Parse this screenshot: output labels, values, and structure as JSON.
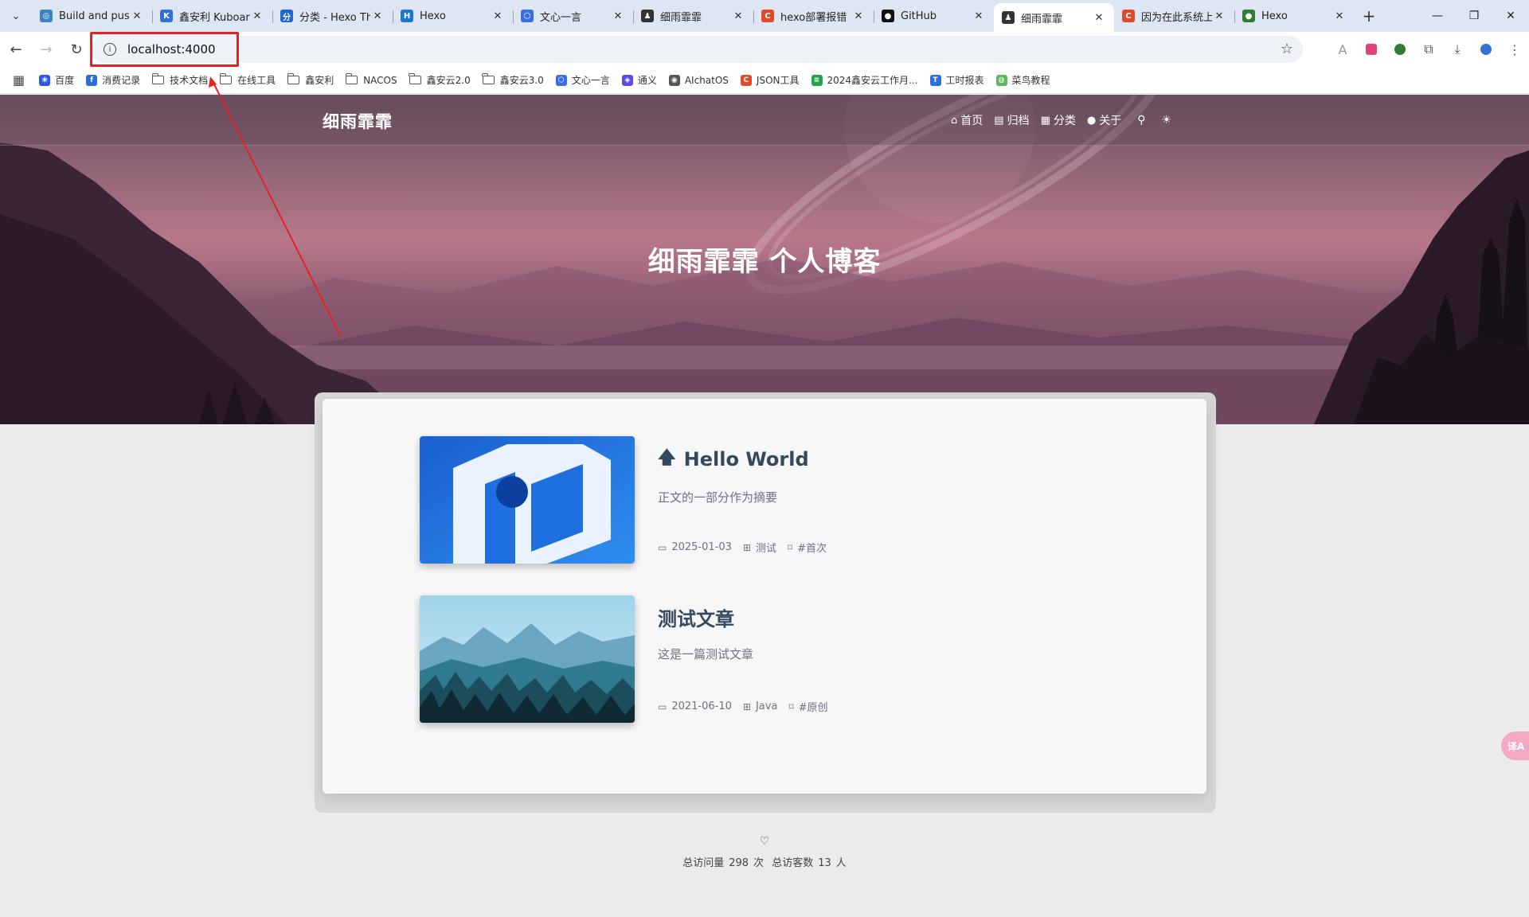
{
  "browser": {
    "tabs": [
      {
        "title": "Build and push",
        "color": "#3b82c4",
        "glyph": "◎"
      },
      {
        "title": "鑫安利 Kuboard",
        "color": "#2f6fdc",
        "glyph": "K"
      },
      {
        "title": "分类 - Hexo Th",
        "color": "#1e66d0",
        "glyph": "分"
      },
      {
        "title": "Hexo",
        "color": "#1976d2",
        "glyph": "H"
      },
      {
        "title": "文心一言",
        "color": "#3b6fe0",
        "glyph": "⬡"
      },
      {
        "title": "细雨霏霏",
        "color": "#333333",
        "glyph": "♟"
      },
      {
        "title": "hexo部署报错",
        "color": "#e0492c",
        "glyph": "C"
      },
      {
        "title": "GitHub",
        "color": "#111111",
        "glyph": "●"
      },
      {
        "title": "细雨霏霏",
        "color": "#333333",
        "glyph": "♟"
      },
      {
        "title": "因为在此系统上",
        "color": "#e0492c",
        "glyph": "C"
      },
      {
        "title": "Hexo",
        "color": "#2e7d32",
        "glyph": "●"
      }
    ],
    "active_tab_index": 8,
    "url": "localhost:4000",
    "bookmarks": [
      {
        "label": "百度",
        "type": "site",
        "color": "#2b56e8",
        "glyph": "❀"
      },
      {
        "label": "消费记录",
        "type": "site",
        "color": "#2a6fdc",
        "glyph": "f"
      },
      {
        "label": "技术文档",
        "type": "folder"
      },
      {
        "label": "在线工具",
        "type": "folder"
      },
      {
        "label": "鑫安利",
        "type": "folder"
      },
      {
        "label": "NACOS",
        "type": "folder"
      },
      {
        "label": "鑫安云2.0",
        "type": "folder"
      },
      {
        "label": "鑫安云3.0",
        "type": "folder"
      },
      {
        "label": "文心一言",
        "type": "site",
        "color": "#3b6fe0",
        "glyph": "⬡"
      },
      {
        "label": "通义",
        "type": "site",
        "color": "#5b4ee0",
        "glyph": "◈"
      },
      {
        "label": "AIchatOS",
        "type": "site",
        "color": "#555555",
        "glyph": "◉"
      },
      {
        "label": "JSON工具",
        "type": "site",
        "color": "#e0492c",
        "glyph": "C"
      },
      {
        "label": "2024鑫安云工作月...",
        "type": "site",
        "color": "#22a34a",
        "glyph": "≡"
      },
      {
        "label": "工时报表",
        "type": "site",
        "color": "#2a6fdc",
        "glyph": "T"
      },
      {
        "label": "菜鸟教程",
        "type": "site",
        "color": "#5cb85c",
        "glyph": "◍"
      }
    ]
  },
  "site": {
    "brand": "细雨霏霏",
    "nav": [
      {
        "label": "首页",
        "icon": "home-icon",
        "glyph": "⌂"
      },
      {
        "label": "归档",
        "icon": "archive-icon",
        "glyph": "▤"
      },
      {
        "label": "分类",
        "icon": "grid-icon",
        "glyph": "▦"
      },
      {
        "label": "关于",
        "icon": "user-icon",
        "glyph": "●"
      }
    ],
    "hero_title": "细雨霏霏 个人博客",
    "posts": [
      {
        "title": "Hello World",
        "pinned": true,
        "excerpt": "正文的一部分作为摘要",
        "date": "2025-01-03",
        "category": "测试",
        "tag": "#首次",
        "thumb": "blue-logo"
      },
      {
        "title": "测试文章",
        "pinned": false,
        "excerpt": "这是一篇测试文章",
        "date": "2021-06-10",
        "category": "Java",
        "tag": "#原创",
        "thumb": "forest"
      }
    ],
    "footer": {
      "visits_label": "总访问量",
      "visits_value": "298",
      "visits_unit": "次",
      "visitors_label": "总访客数",
      "visitors_value": "13",
      "visitors_unit": "人"
    },
    "side_widget": "译A"
  },
  "colors": {
    "annotation_red": "#e02424",
    "title_color": "#34495e",
    "meta_color": "#6b7280"
  }
}
